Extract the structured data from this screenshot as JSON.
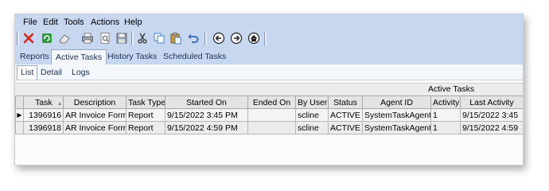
{
  "menu": [
    "File",
    "Edit",
    "Tools",
    "Actions",
    "Help"
  ],
  "toolbar": {
    "icons": [
      "close-icon",
      "refresh-icon",
      "eraser-icon",
      "print-icon",
      "print-preview-icon",
      "save-icon",
      "cut-icon",
      "copy-icon",
      "paste-icon",
      "undo-icon",
      "back-icon",
      "forward-icon",
      "home-icon"
    ]
  },
  "tabs": {
    "main": [
      "Reports",
      "Active Tasks",
      "History Tasks",
      "Scheduled Tasks"
    ],
    "main_active": "Active Tasks",
    "sub": [
      "List",
      "Detail",
      "Logs"
    ],
    "sub_active": "List"
  },
  "grid": {
    "title": "Active Tasks",
    "sort_indicator": "▲",
    "row_indicator": "▶",
    "columns": [
      "Task",
      "Description",
      "Task Type",
      "Started On",
      "Ended On",
      "By User",
      "Status",
      "Agent ID",
      "Activity",
      "Last Activity"
    ],
    "rows": [
      {
        "task": "1396916",
        "description": "AR Invoice Form",
        "task_type": "Report",
        "started_on": "9/15/2022 3:45 PM",
        "ended_on": "",
        "by_user": "scline",
        "status": "ACTIVE",
        "agent_id": "SystemTaskAgent",
        "activity": "1",
        "last_activity": "9/15/2022 3:45"
      },
      {
        "task": "1396918",
        "description": "AR Invoice Form",
        "task_type": "Report",
        "started_on": "9/15/2022 4:59 PM",
        "ended_on": "",
        "by_user": "scline",
        "status": "ACTIVE",
        "agent_id": "SystemTaskAgent",
        "activity": "1",
        "last_activity": "9/15/2022 4:59"
      }
    ]
  }
}
